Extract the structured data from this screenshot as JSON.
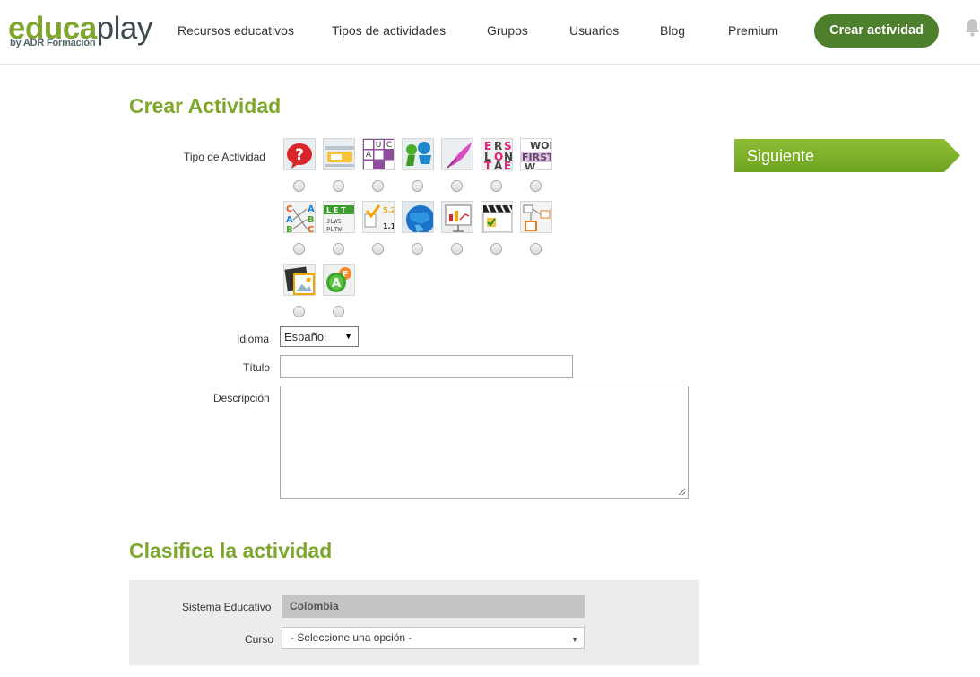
{
  "brand": {
    "name_part1": "educa",
    "name_part2": "play",
    "subtitle": "by ADR Formación"
  },
  "nav": {
    "items": [
      "Recursos educativos",
      "Tipos de actividades",
      "Grupos",
      "Usuarios",
      "Blog",
      "Premium"
    ],
    "cta": "Crear actividad"
  },
  "page": {
    "title": "Crear Actividad",
    "tipo_label": "Tipo de Actividad",
    "idioma_label": "Idioma",
    "idioma_value": "Español",
    "titulo_label": "Título",
    "titulo_value": "",
    "descripcion_label": "Descripción",
    "descripcion_value": "",
    "next_button": "Siguiente"
  },
  "activity_types": [
    {
      "icon": "quiz-question-icon"
    },
    {
      "icon": "complete-text-icon"
    },
    {
      "icon": "crossword-icon"
    },
    {
      "icon": "dialogue-icon"
    },
    {
      "icon": "dictation-quill-icon"
    },
    {
      "icon": "alphabet-letters-icon"
    },
    {
      "icon": "word-search-icon"
    },
    {
      "icon": "matching-columns-icon"
    },
    {
      "icon": "hangman-letters-icon"
    },
    {
      "icon": "test-answers-icon"
    },
    {
      "icon": "map-globe-icon"
    },
    {
      "icon": "presentation-chart-icon"
    },
    {
      "icon": "video-quiz-icon"
    },
    {
      "icon": "concept-map-icon"
    },
    {
      "icon": "image-gallery-icon"
    },
    {
      "icon": "letters-game-icon"
    }
  ],
  "classify": {
    "title": "Clasifica la actividad",
    "sistema_label": "Sistema Educativo",
    "sistema_value": "Colombia",
    "curso_label": "Curso",
    "curso_value": "- Seleccione una opción -"
  },
  "colors": {
    "brand_green": "#7ea52d",
    "cta_green": "#4e7f2c",
    "next_green": "#8ab933"
  }
}
